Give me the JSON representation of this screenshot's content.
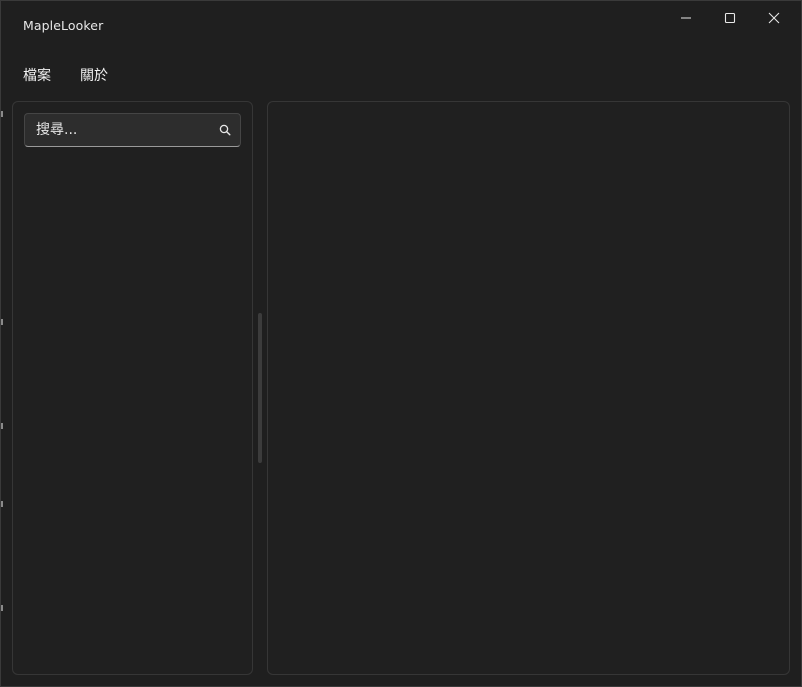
{
  "window": {
    "title": "MapleLooker"
  },
  "caption_buttons": {
    "minimize_icon": "minimize-icon",
    "maximize_icon": "maximize-icon",
    "close_icon": "close-icon"
  },
  "menu": {
    "items": [
      {
        "label": "檔案"
      },
      {
        "label": "關於"
      }
    ]
  },
  "left_pane": {
    "search": {
      "placeholder": "搜尋...",
      "value": "",
      "icon": "search-icon"
    }
  },
  "colors": {
    "window_background": "#1f1f1f",
    "pane_background": "#202020",
    "pane_border": "#363636",
    "text": "#ffffff"
  }
}
